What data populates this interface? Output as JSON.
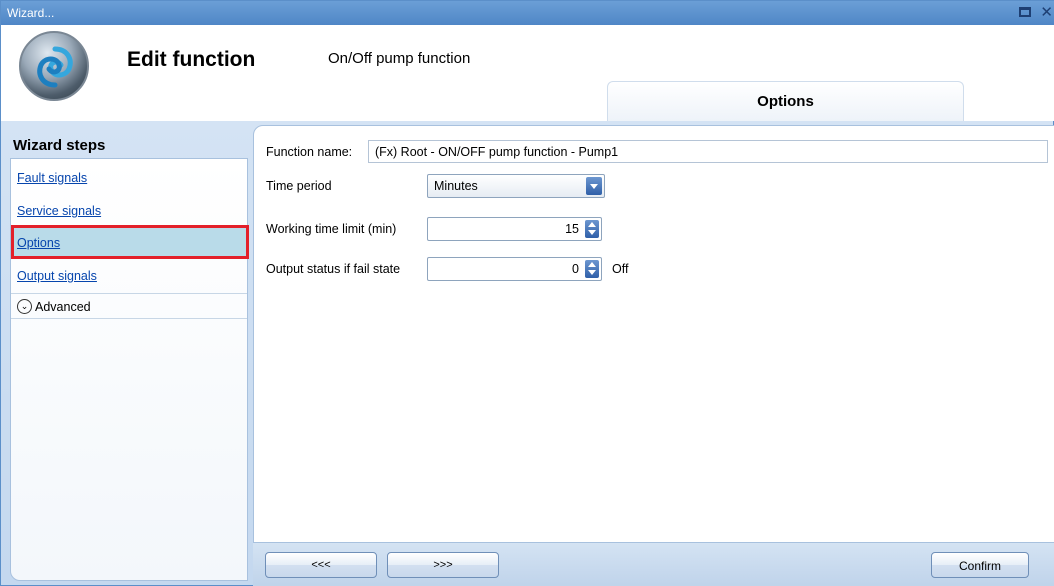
{
  "window": {
    "title": "Wizard..."
  },
  "header": {
    "title": "Edit function",
    "subtitle": "On/Off pump function",
    "tab": "Options"
  },
  "sidebar": {
    "heading": "Wizard steps",
    "items": [
      {
        "label": "Fault signals"
      },
      {
        "label": "Service signals"
      },
      {
        "label": "Options",
        "active": true
      },
      {
        "label": "Output signals"
      }
    ],
    "advanced": "Advanced"
  },
  "form": {
    "function_name_label": "Function name:",
    "function_name_value": "(Fx) Root - ON/OFF pump function - Pump1",
    "time_period_label": "Time period",
    "time_period_value": "Minutes",
    "working_time_label": "Working time limit (min)",
    "working_time_value": "15",
    "output_status_label": "Output status if fail state",
    "output_status_value": "0",
    "output_status_text": "Off"
  },
  "buttons": {
    "prev": "<<<",
    "next": ">>>",
    "confirm": "Confirm"
  },
  "colors": {
    "highlight": "#e3202a",
    "active_step": "#b9dbe9",
    "link": "#0645ad"
  }
}
